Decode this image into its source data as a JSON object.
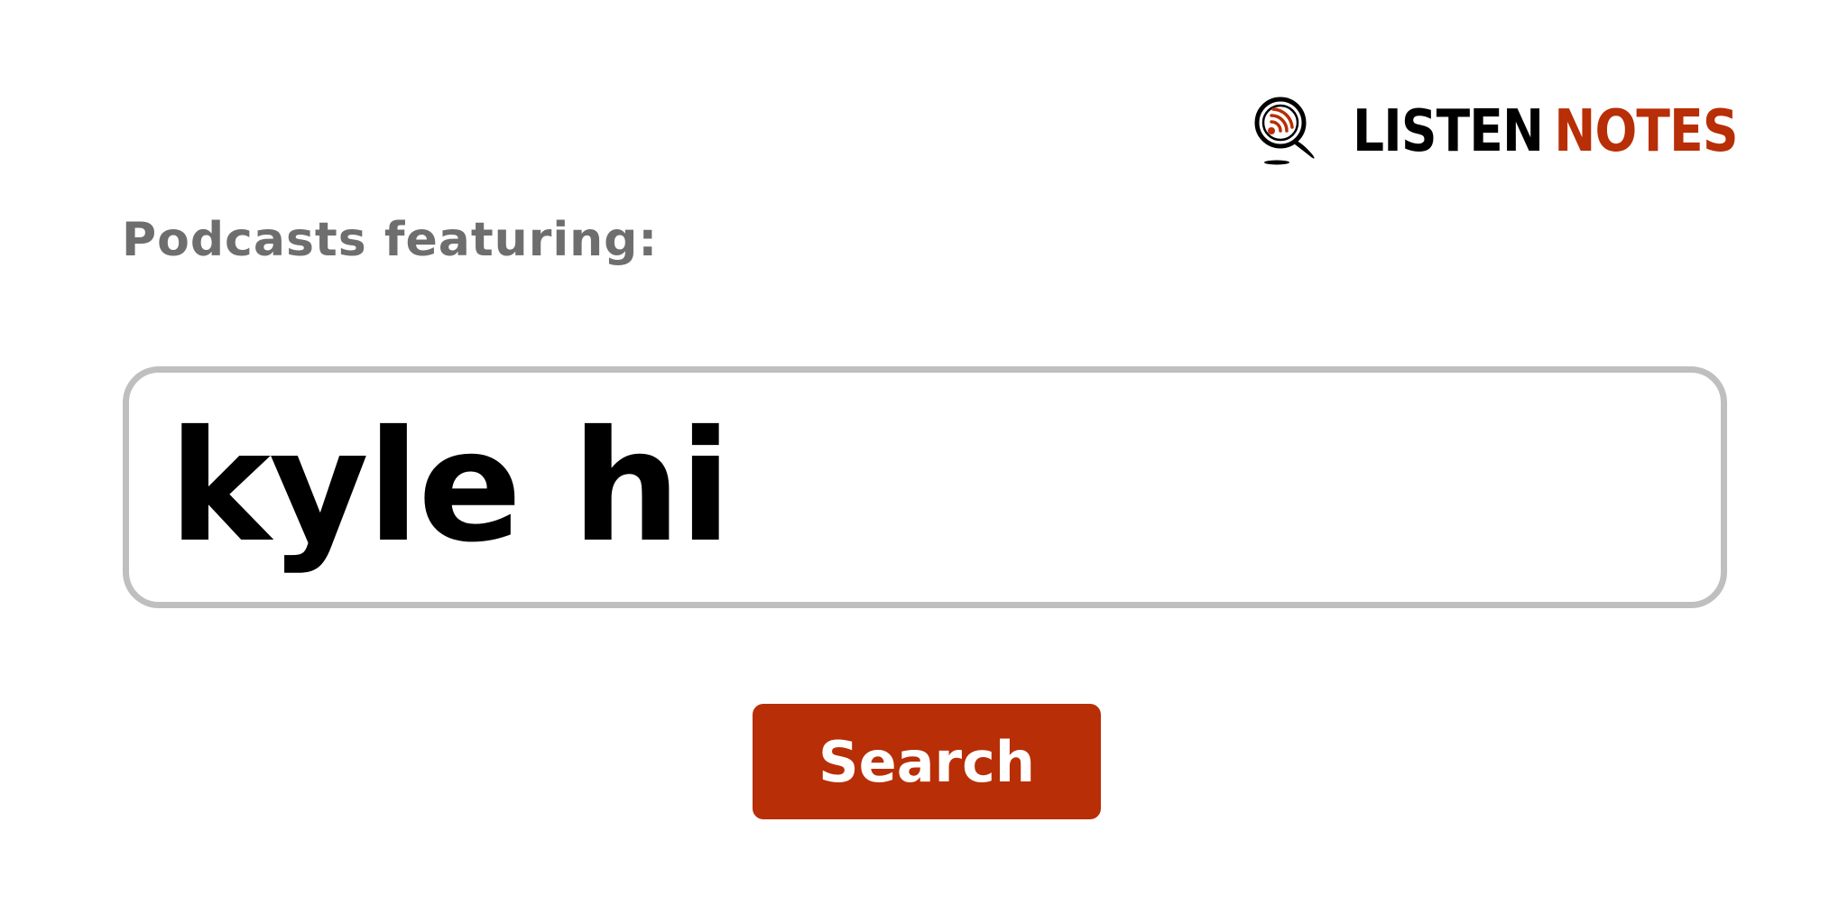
{
  "logo": {
    "word_1": "LISTEN",
    "word_2": "NOTES",
    "icon": "magnifier-rss-icon"
  },
  "heading": "Podcasts featuring:",
  "search": {
    "value": "kyle hi",
    "placeholder": ""
  },
  "button": {
    "label": "Search"
  },
  "colors": {
    "brand": "#b82e06",
    "heading": "#6e6e6e",
    "border": "#bfbfbf"
  }
}
